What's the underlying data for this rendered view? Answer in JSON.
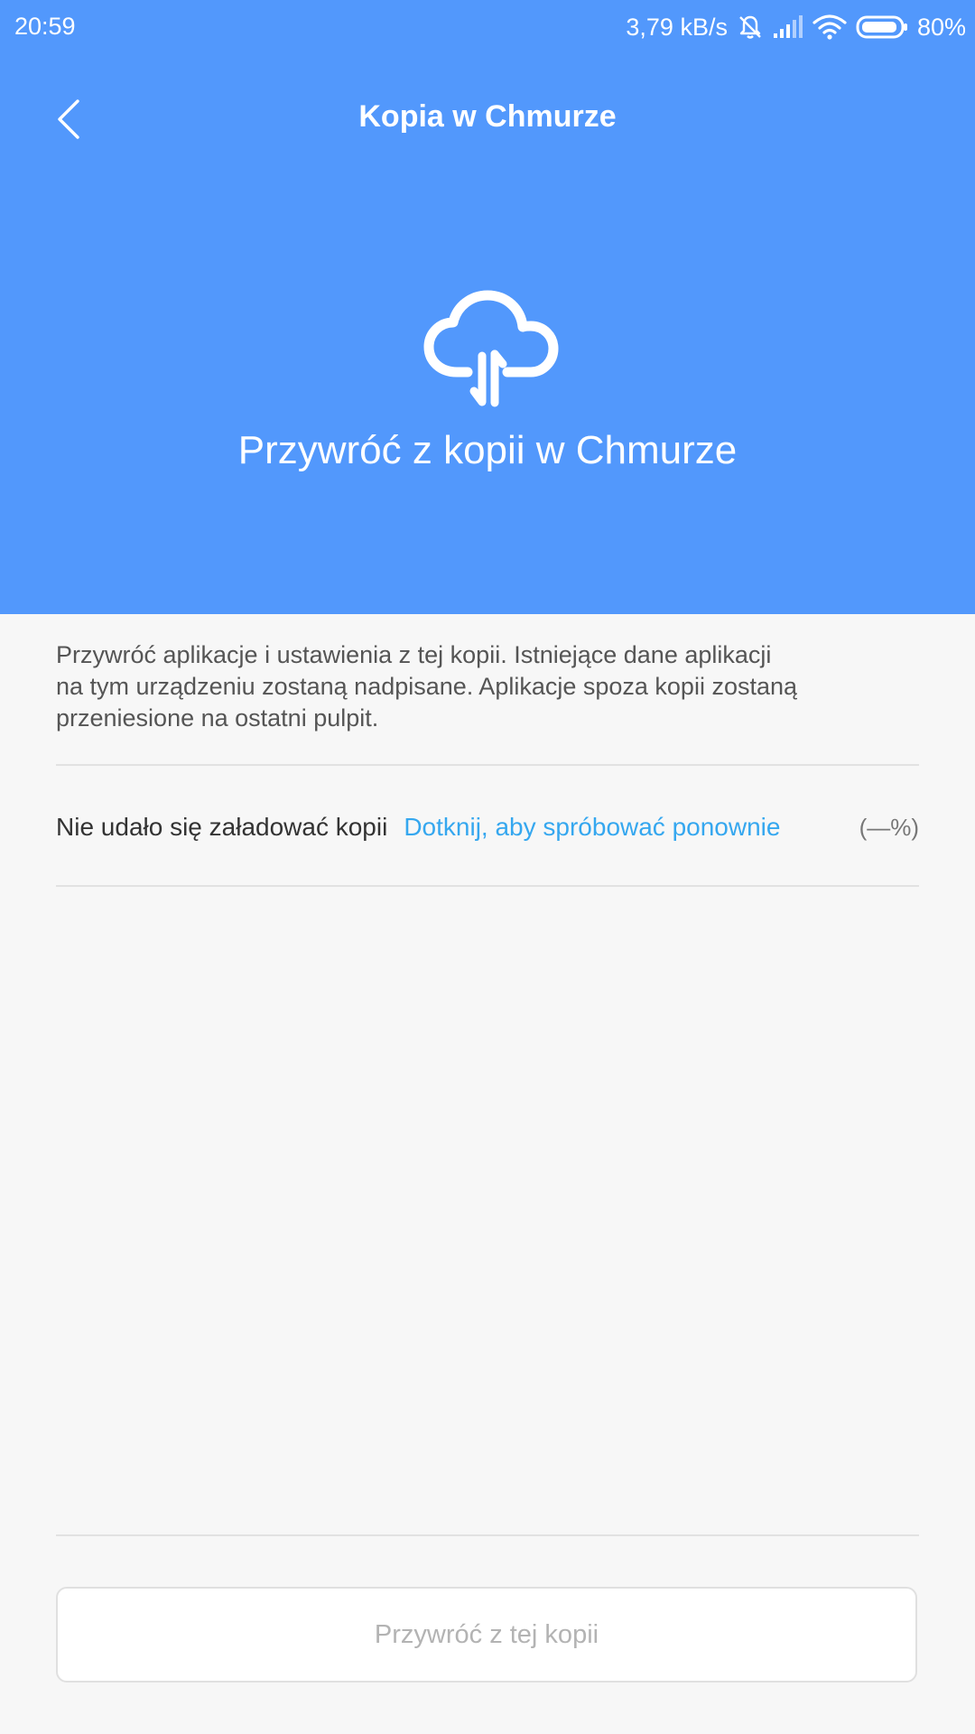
{
  "status_bar": {
    "time": "20:59",
    "speed": "3,79 kB/s",
    "battery": "80%",
    "icons": [
      "bell-muted-icon",
      "signal-icon",
      "wifi-icon",
      "battery-icon"
    ]
  },
  "header": {
    "title": "Kopia w Chmurze",
    "hero_title": "Przywróć z kopii w Chmurze",
    "icon": "cloud-sync-icon",
    "background_color": "#5298fc"
  },
  "description": {
    "lines": [
      "Przywróć aplikacje i ustawienia z tej kopii. Istniejące dane aplikacji",
      "na tym urządzeniu zostaną nadpisane. Aplikacje spoza kopii zostaną",
      "przeniesione na ostatni pulpit."
    ]
  },
  "load_status": {
    "error": "Nie udało się załadować kopii",
    "retry": "Dotknij, aby spróbować ponownie",
    "percent": "(—%)"
  },
  "footer": {
    "restore_label": "Przywróć z tej kopii"
  },
  "colors": {
    "accent": "#35a7ef",
    "header": "#5298fc"
  }
}
